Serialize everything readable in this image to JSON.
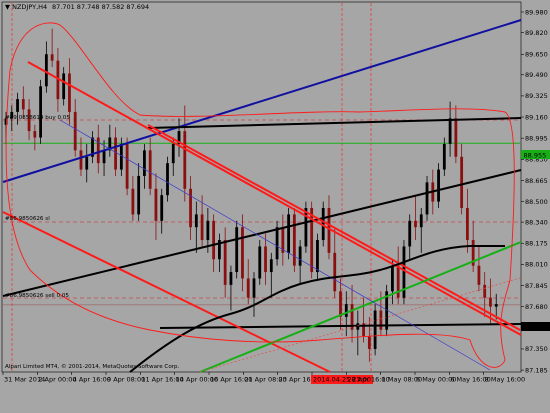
{
  "header": {
    "symbol_tf": "NZDJPY,H4",
    "ohlc": "87.701 87.748 87.582 87.694"
  },
  "copyright": "Alpari Limited MT4, © 2001-2014, MetaQuotes Software Corp.",
  "price_tags": {
    "current": "87.694",
    "reference": "88.955"
  },
  "colors": {
    "background": "#a6a6a6",
    "bull_candle": "#000000",
    "bear_candle": "#8a1010",
    "channel_red": "#ff1a1a",
    "trend_blue": "#1010a0",
    "trend_green": "#16b016",
    "level_black": "#000000"
  },
  "annotations": [
    {
      "text": "#89.0858614 buy 0.05"
    },
    {
      "text": "#86.9850626 sl"
    },
    {
      "text": "#86.9850626 sell 0.05"
    }
  ],
  "chart_data": {
    "type": "candlestick",
    "title": "",
    "ylim": [
      87.17,
      90.05
    ],
    "y_ticks": [
      "89.980",
      "89.820",
      "89.650",
      "89.490",
      "89.325",
      "89.160",
      "88.995",
      "88.830",
      "88.665",
      "88.500",
      "88.340",
      "88.175",
      "88.010",
      "87.845",
      "87.680",
      "87.515",
      "87.350",
      "87.185"
    ],
    "x_labels": [
      "31 Mar 2014",
      "2 Apr 00:00",
      "4 Apr 16:00",
      "9 Apr 08:00",
      "11 Apr 16:00",
      "14 Apr 00:00",
      "16 Apr 16:00",
      "21 Apr 08:00",
      "23 Apr 16:00",
      "2014.04.25 23:00",
      "28 Apr 16:00",
      "1 May 08:00",
      "6 May 00:00",
      "6 May 16:00",
      "8 May 16:00"
    ],
    "x_labels_highlighted": [
      "2014.04.25 23:00"
    ],
    "levels": [
      {
        "name": "current price",
        "value": 87.694
      },
      {
        "name": "green horizontal",
        "value": 88.955
      }
    ],
    "bars": [
      [
        89.1,
        89.2,
        88.95,
        89.15
      ],
      [
        89.15,
        89.25,
        89.05,
        89.2
      ],
      [
        89.2,
        89.35,
        89.1,
        89.3
      ],
      [
        89.3,
        89.4,
        89.15,
        89.22
      ],
      [
        89.22,
        89.3,
        88.98,
        89.05
      ],
      [
        89.05,
        89.1,
        88.9,
        89.0
      ],
      [
        89.0,
        89.45,
        88.95,
        89.4
      ],
      [
        89.4,
        89.75,
        89.35,
        89.65
      ],
      [
        89.65,
        89.85,
        89.55,
        89.6
      ],
      [
        89.6,
        89.7,
        89.2,
        89.3
      ],
      [
        89.3,
        89.55,
        89.25,
        89.5
      ],
      [
        89.5,
        89.62,
        89.1,
        89.2
      ],
      [
        89.2,
        89.3,
        88.85,
        88.9
      ],
      [
        88.9,
        89.0,
        88.7,
        88.75
      ],
      [
        88.75,
        88.95,
        88.65,
        88.85
      ],
      [
        88.85,
        89.05,
        88.8,
        89.0
      ],
      [
        89.0,
        89.1,
        88.72,
        88.8
      ],
      [
        88.8,
        88.98,
        88.7,
        88.9
      ],
      [
        88.9,
        89.1,
        88.85,
        89.0
      ],
      [
        89.0,
        89.08,
        88.7,
        88.75
      ],
      [
        88.75,
        89.0,
        88.7,
        88.95
      ],
      [
        88.95,
        89.0,
        88.55,
        88.6
      ],
      [
        88.6,
        88.7,
        88.35,
        88.4
      ],
      [
        88.4,
        88.8,
        88.35,
        88.7
      ],
      [
        88.7,
        88.95,
        88.6,
        88.9
      ],
      [
        88.9,
        89.0,
        88.55,
        88.6
      ],
      [
        88.6,
        88.72,
        88.2,
        88.35
      ],
      [
        88.35,
        88.6,
        88.25,
        88.55
      ],
      [
        88.55,
        88.85,
        88.5,
        88.8
      ],
      [
        88.8,
        89.0,
        88.7,
        88.95
      ],
      [
        88.95,
        89.15,
        88.85,
        89.05
      ],
      [
        89.05,
        89.25,
        88.5,
        88.6
      ],
      [
        88.6,
        88.7,
        88.2,
        88.3
      ],
      [
        88.3,
        88.5,
        88.1,
        88.4
      ],
      [
        88.4,
        88.55,
        88.15,
        88.2
      ],
      [
        88.2,
        88.45,
        88.1,
        88.35
      ],
      [
        88.35,
        88.4,
        87.95,
        88.05
      ],
      [
        88.05,
        88.25,
        87.95,
        88.2
      ],
      [
        88.2,
        88.3,
        87.75,
        87.85
      ],
      [
        87.85,
        88.0,
        87.65,
        87.95
      ],
      [
        87.95,
        88.35,
        87.9,
        88.3
      ],
      [
        88.3,
        88.4,
        87.8,
        87.9
      ],
      [
        87.9,
        88.05,
        87.7,
        87.75
      ],
      [
        87.75,
        87.95,
        87.6,
        87.9
      ],
      [
        87.9,
        88.2,
        87.85,
        88.15
      ],
      [
        88.15,
        88.25,
        87.85,
        87.95
      ],
      [
        87.95,
        88.1,
        87.75,
        88.05
      ],
      [
        88.05,
        88.35,
        88.0,
        88.3
      ],
      [
        88.3,
        88.4,
        88.0,
        88.1
      ],
      [
        88.1,
        88.45,
        88.05,
        88.4
      ],
      [
        88.4,
        88.45,
        87.95,
        88.0
      ],
      [
        88.0,
        88.2,
        87.85,
        88.15
      ],
      [
        88.15,
        88.5,
        88.1,
        88.45
      ],
      [
        88.45,
        88.5,
        87.9,
        87.95
      ],
      [
        87.95,
        88.25,
        87.88,
        88.2
      ],
      [
        88.2,
        88.5,
        88.15,
        88.45
      ],
      [
        88.45,
        88.55,
        88.05,
        88.1
      ],
      [
        88.1,
        88.3,
        87.75,
        87.8
      ],
      [
        87.8,
        87.9,
        87.5,
        87.6
      ],
      [
        87.6,
        87.8,
        87.45,
        87.7
      ],
      [
        87.7,
        87.85,
        87.4,
        87.5
      ],
      [
        87.5,
        87.65,
        87.3,
        87.55
      ],
      [
        87.55,
        87.75,
        87.4,
        87.45
      ],
      [
        87.45,
        87.6,
        87.25,
        87.35
      ],
      [
        87.35,
        87.7,
        87.3,
        87.65
      ],
      [
        87.65,
        87.8,
        87.45,
        87.5
      ],
      [
        87.5,
        87.85,
        87.45,
        87.8
      ],
      [
        87.8,
        88.05,
        87.7,
        88.0
      ],
      [
        88.0,
        88.15,
        87.7,
        87.75
      ],
      [
        87.75,
        88.2,
        87.7,
        88.15
      ],
      [
        88.15,
        88.4,
        88.05,
        88.35
      ],
      [
        88.35,
        88.55,
        88.2,
        88.3
      ],
      [
        88.3,
        88.45,
        88.1,
        88.4
      ],
      [
        88.4,
        88.7,
        88.35,
        88.65
      ],
      [
        88.65,
        88.75,
        88.4,
        88.5
      ],
      [
        88.5,
        88.8,
        88.45,
        88.75
      ],
      [
        88.75,
        89.0,
        88.7,
        88.95
      ],
      [
        88.95,
        89.28,
        88.85,
        89.15
      ],
      [
        89.15,
        89.25,
        88.8,
        88.85
      ],
      [
        88.85,
        88.95,
        88.4,
        88.45
      ],
      [
        88.45,
        88.6,
        88.1,
        88.2
      ],
      [
        88.2,
        88.35,
        87.95,
        88.0
      ],
      [
        88.0,
        88.15,
        87.8,
        87.85
      ],
      [
        87.85,
        87.95,
        87.6,
        87.75
      ],
      [
        87.75,
        87.9,
        87.55,
        87.68
      ],
      [
        87.68,
        87.78,
        87.58,
        87.7
      ]
    ]
  }
}
